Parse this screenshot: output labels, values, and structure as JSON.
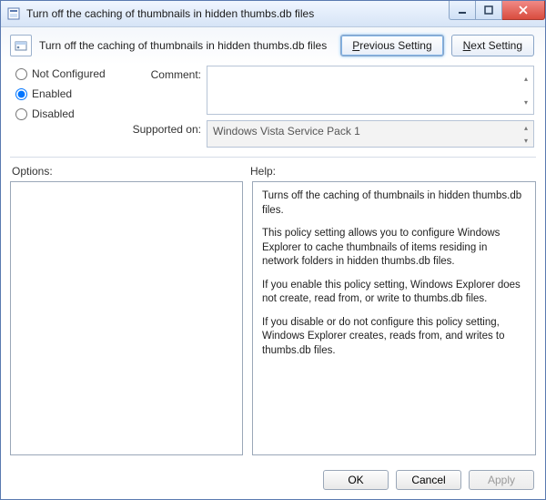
{
  "window": {
    "title": "Turn off the caching of thumbnails in hidden thumbs.db files"
  },
  "header": {
    "policy_title": "Turn off the caching of thumbnails in hidden thumbs.db files",
    "prev_prefix": "P",
    "prev_rest": "revious Setting",
    "next_prefix": "N",
    "next_rest": "ext Setting"
  },
  "state": {
    "not_configured": "Not Configured",
    "enabled": "Enabled",
    "disabled": "Disabled",
    "selected": "enabled"
  },
  "fields": {
    "comment_label": "Comment:",
    "comment_value": "",
    "supported_label": "Supported on:",
    "supported_value": "Windows Vista Service Pack 1"
  },
  "sections": {
    "options": "Options:",
    "help": "Help:"
  },
  "help": {
    "p1": "Turns off the caching of thumbnails in hidden thumbs.db files.",
    "p2": "This policy setting allows you to configure Windows Explorer to cache thumbnails of items residing in network folders in hidden thumbs.db files.",
    "p3": "If you enable this policy setting, Windows Explorer does not create, read from, or write to thumbs.db files.",
    "p4": "If you disable or do not configure this policy setting, Windows Explorer creates, reads from, and writes to thumbs.db files."
  },
  "buttons": {
    "ok": "OK",
    "cancel": "Cancel",
    "apply": "Apply"
  }
}
